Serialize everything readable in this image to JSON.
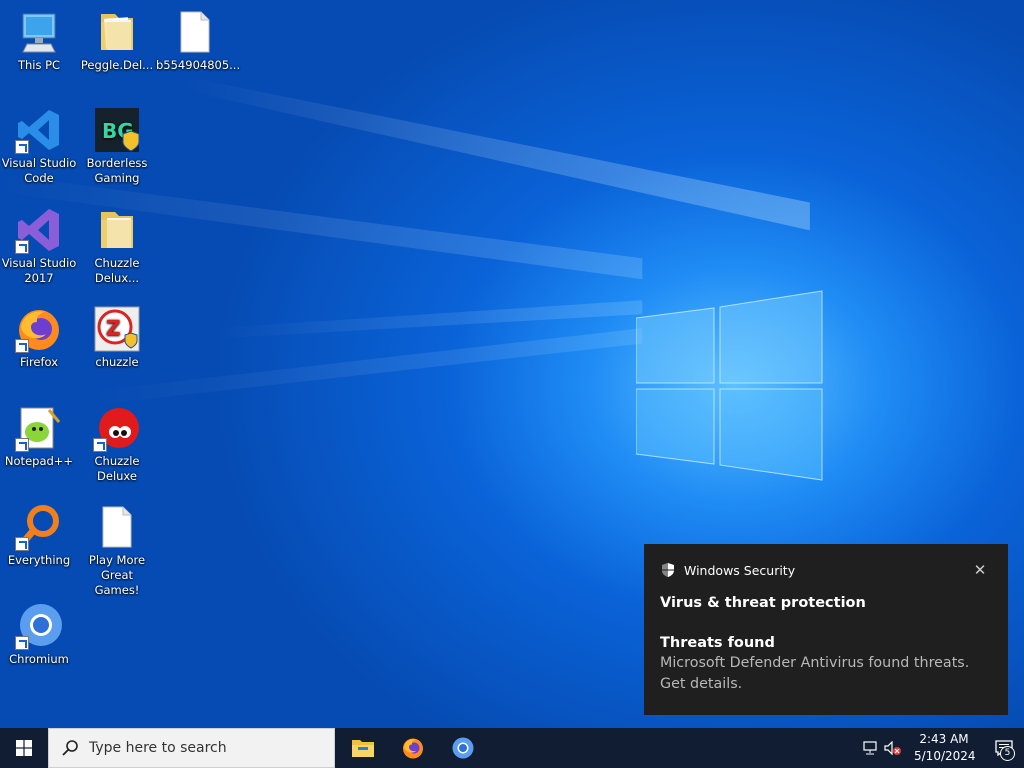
{
  "desktop": {
    "icons": [
      {
        "label": "This PC",
        "icon": "computer-icon"
      },
      {
        "label": "Peggle.Del...",
        "icon": "folder-icon"
      },
      {
        "label": "b554904805...",
        "icon": "file-icon"
      },
      {
        "label": "Visual Studio Code",
        "icon": "vscode-icon"
      },
      {
        "label": "Borderless Gaming",
        "icon": "borderless-gaming-icon"
      },
      {
        "label": "Visual Studio 2017",
        "icon": "visual-studio-icon"
      },
      {
        "label": "Chuzzle Delux...",
        "icon": "folder-icon"
      },
      {
        "label": "Firefox",
        "icon": "firefox-icon"
      },
      {
        "label": "chuzzle",
        "icon": "chuzzle-app-icon"
      },
      {
        "label": "Notepad++",
        "icon": "notepadpp-icon"
      },
      {
        "label": "Chuzzle Deluxe",
        "icon": "chuzzle-deluxe-icon"
      },
      {
        "label": "Everything",
        "icon": "everything-search-icon"
      },
      {
        "label": "Play More Great Games!",
        "icon": "file-icon"
      },
      {
        "label": "Chromium",
        "icon": "chromium-icon"
      }
    ]
  },
  "notification": {
    "app_name": "Windows Security",
    "title": "Virus & threat protection",
    "subtitle": "Threats found",
    "body": "Microsoft Defender Antivirus found threats. Get details.",
    "close_icon": "close-icon"
  },
  "taskbar": {
    "search_placeholder": "Type here to search",
    "pinned": [
      "file-explorer-icon",
      "firefox-icon",
      "chromium-icon"
    ],
    "clock_time": "2:43 AM",
    "clock_date": "5/10/2024",
    "notification_count": "5"
  },
  "colors": {
    "desktop_blue": "#0a63d8",
    "taskbar": "#101d33",
    "toast_bg": "#1f1f1f"
  }
}
